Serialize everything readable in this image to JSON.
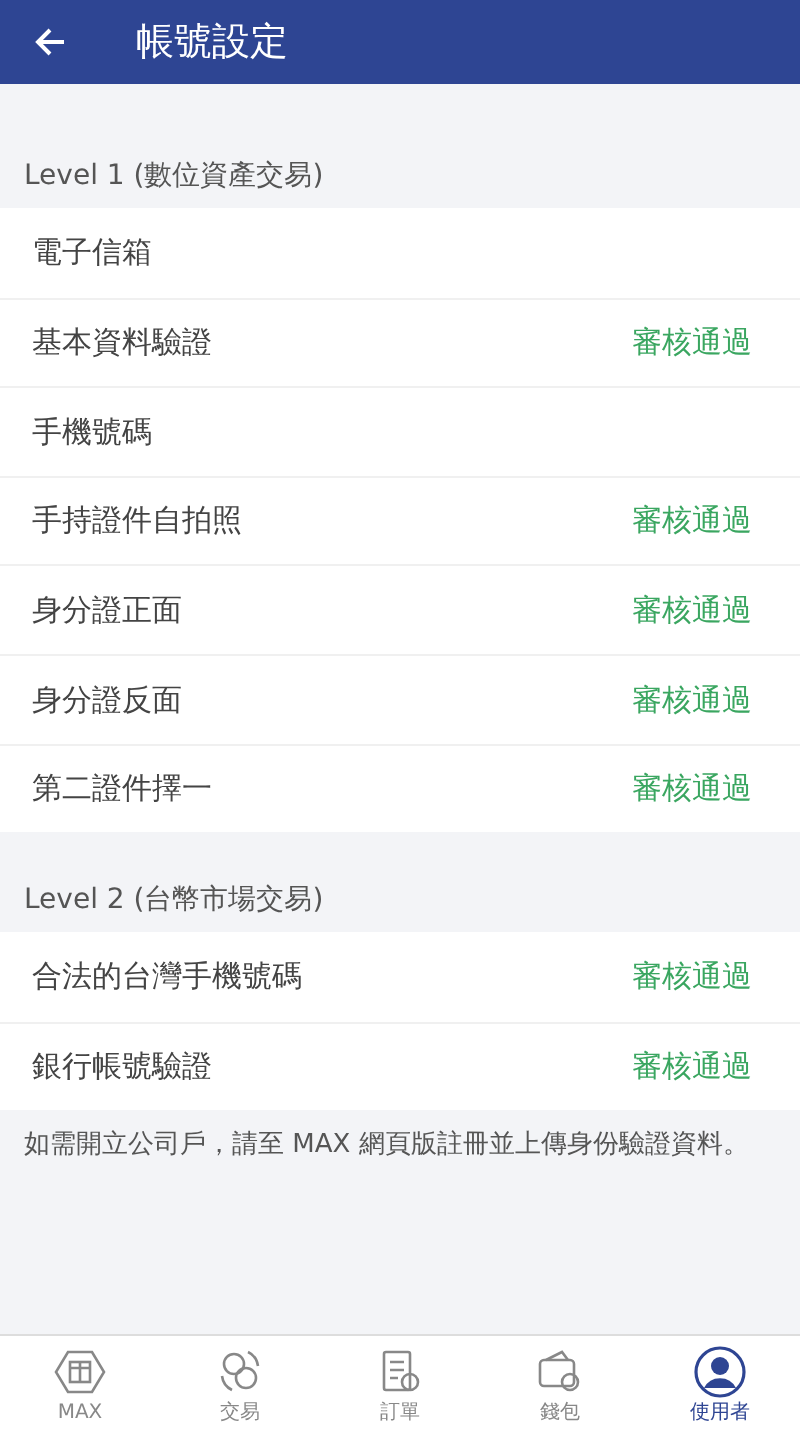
{
  "header": {
    "title": "帳號設定"
  },
  "sections": [
    {
      "title": "Level 1 (數位資產交易)",
      "rows": [
        {
          "label": "電子信箱"
        },
        {
          "label": "基本資料驗證",
          "status": "審核通過"
        },
        {
          "label": "手機號碼"
        },
        {
          "label": "手持證件自拍照",
          "status": "審核通過"
        },
        {
          "label": "身分證正面",
          "status": "審核通過"
        },
        {
          "label": "身分證反面",
          "status": "審核通過"
        },
        {
          "label": "第二證件擇一",
          "status": "審核通過"
        }
      ]
    },
    {
      "title": "Level 2 (台幣市場交易)",
      "rows": [
        {
          "label": "合法的台灣手機號碼",
          "status": "審核通過"
        },
        {
          "label": "銀行帳號驗證",
          "status": "審核通過"
        }
      ]
    }
  ],
  "note": "如需開立公司戶，請至 MAX 網頁版註冊並上傳身份驗證資料。",
  "tabs": [
    {
      "kind": "max",
      "label": "MAX",
      "selected": false
    },
    {
      "kind": "trade",
      "label": "交易",
      "selected": false
    },
    {
      "kind": "orders",
      "label": "訂單",
      "selected": false
    },
    {
      "kind": "wallet",
      "label": "錢包",
      "selected": false
    },
    {
      "kind": "user",
      "label": "使用者",
      "selected": true
    }
  ]
}
